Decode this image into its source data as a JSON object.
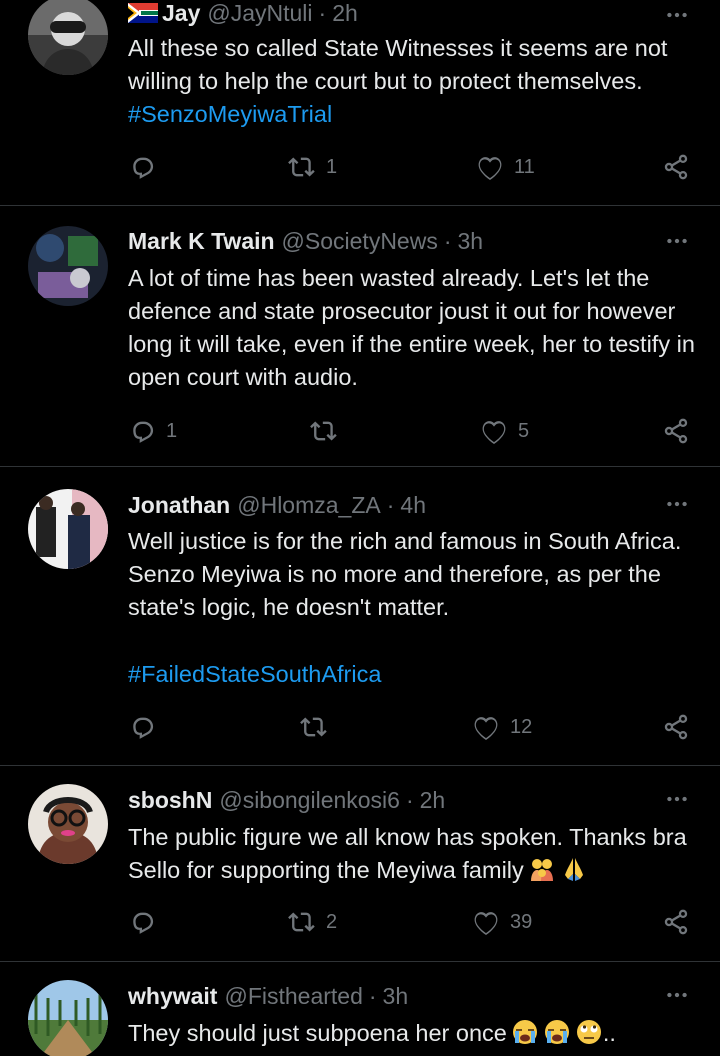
{
  "tweets": [
    {
      "name": "Jay",
      "handle": "@JayNtuli",
      "time": "2h",
      "text": "All these so called State Witnesses it seems are not willing to help the court but to protect themselves. ",
      "hashtag": "#SenzoMeyiwaTrial",
      "replies": "",
      "retweets": "1",
      "likes": "11"
    },
    {
      "name": "Mark K Twain",
      "handle": "@SocietyNews",
      "time": "3h",
      "text": "A lot of time has been wasted already. Let's let the defence and state prosecutor joust it out for however long it will take, even if the entire week, her to testify in open court with audio.",
      "replies": "1",
      "retweets": "",
      "likes": "5"
    },
    {
      "name": "Jonathan",
      "handle": "@Hlomza_ZA",
      "time": "4h",
      "text": "Well justice is for the rich and famous in South Africa. Senzo Meyiwa is no more and therefore, as per the state's logic, he doesn't matter.",
      "hashtag": "#FailedStateSouthAfrica",
      "replies": "",
      "retweets": "",
      "likes": "12"
    },
    {
      "name": "sboshN",
      "handle": "@sibongilenkosi6",
      "time": "2h",
      "text": "The public figure we all know has spoken. Thanks bra Sello for supporting the Meyiwa family",
      "replies": "",
      "retweets": "2",
      "likes": "39"
    },
    {
      "name": "whywait",
      "handle": "@Fisthearted",
      "time": "3h",
      "text": "They should just subpoena her once",
      "trail": ".."
    }
  ],
  "colors": {
    "background": "#000000",
    "text": "#e7e9ea",
    "muted": "#71767b",
    "link": "#1d9bf0",
    "divider": "#2f3336"
  },
  "icons": {
    "reply": "reply-icon",
    "retweet": "retweet-icon",
    "like": "heart-icon",
    "share": "share-icon",
    "more": "more-icon"
  }
}
